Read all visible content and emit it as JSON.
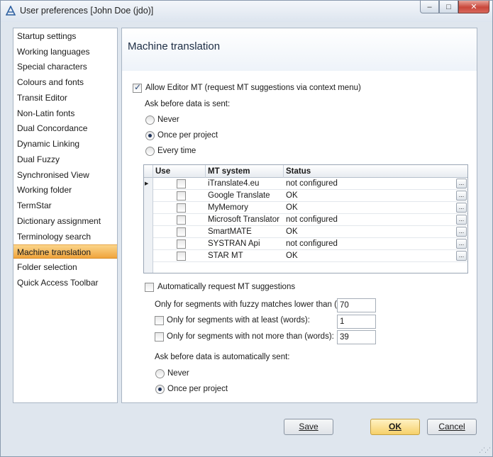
{
  "window": {
    "title": "User preferences [John Doe (jdo)]",
    "minimize_glyph": "–",
    "maximize_glyph": "□",
    "close_glyph": "✕"
  },
  "nav": {
    "items": [
      {
        "label": "Startup settings"
      },
      {
        "label": "Working languages"
      },
      {
        "label": "Special characters"
      },
      {
        "label": "Colours and fonts"
      },
      {
        "label": "Transit Editor"
      },
      {
        "label": "Non-Latin fonts"
      },
      {
        "label": "Dual Concordance"
      },
      {
        "label": "Dynamic Linking"
      },
      {
        "label": "Dual Fuzzy"
      },
      {
        "label": "Synchronised View"
      },
      {
        "label": "Working folder"
      },
      {
        "label": "TermStar"
      },
      {
        "label": "Dictionary assignment"
      },
      {
        "label": "Terminology search"
      },
      {
        "label": "Machine translation",
        "selected": true
      },
      {
        "label": "Folder selection"
      },
      {
        "label": "Quick Access Toolbar"
      }
    ]
  },
  "panel": {
    "title": "Machine translation",
    "allow_mt": {
      "label": "Allow Editor MT (request MT suggestions via context menu)",
      "checked": true
    },
    "ask_before_label": "Ask before data is sent:",
    "ask_options": [
      {
        "label": "Never",
        "checked": false
      },
      {
        "label": "Once per project",
        "checked": true
      },
      {
        "label": "Every time",
        "checked": false
      }
    ],
    "grid": {
      "columns": [
        "Use",
        "MT system",
        "Status"
      ],
      "rows": [
        {
          "system": "iTranslate4.eu",
          "status": "not configured",
          "use": false,
          "current": true
        },
        {
          "system": "Google Translate",
          "status": "OK",
          "use": false
        },
        {
          "system": "MyMemory",
          "status": "OK",
          "use": false
        },
        {
          "system": "Microsoft Translator",
          "status": "not configured",
          "use": false
        },
        {
          "system": "SmartMATE",
          "status": "OK",
          "use": false
        },
        {
          "system": "SYSTRAN Api",
          "status": "not configured",
          "use": false
        },
        {
          "system": "STAR MT",
          "status": "OK",
          "use": false
        }
      ],
      "ellipsis": "...",
      "current_row_glyph": "▶"
    },
    "auto_request": {
      "label": "Automatically request MT suggestions",
      "checked": false
    },
    "fuzzy_label": "Only for segments with fuzzy matches lower than (%):",
    "fuzzy_value": "70",
    "at_least": {
      "label": "Only for segments with at least (words):",
      "checked": false,
      "value": "1"
    },
    "not_more": {
      "label": "Only for segments with not more than (words):",
      "checked": false,
      "value": "39"
    },
    "auto_ask_label": "Ask before data is automatically sent:",
    "auto_ask_options": [
      {
        "label": "Never",
        "checked": false
      },
      {
        "label": "Once per project",
        "checked": true
      }
    ]
  },
  "buttons": {
    "save": "Save",
    "ok": "OK",
    "cancel": "Cancel"
  }
}
